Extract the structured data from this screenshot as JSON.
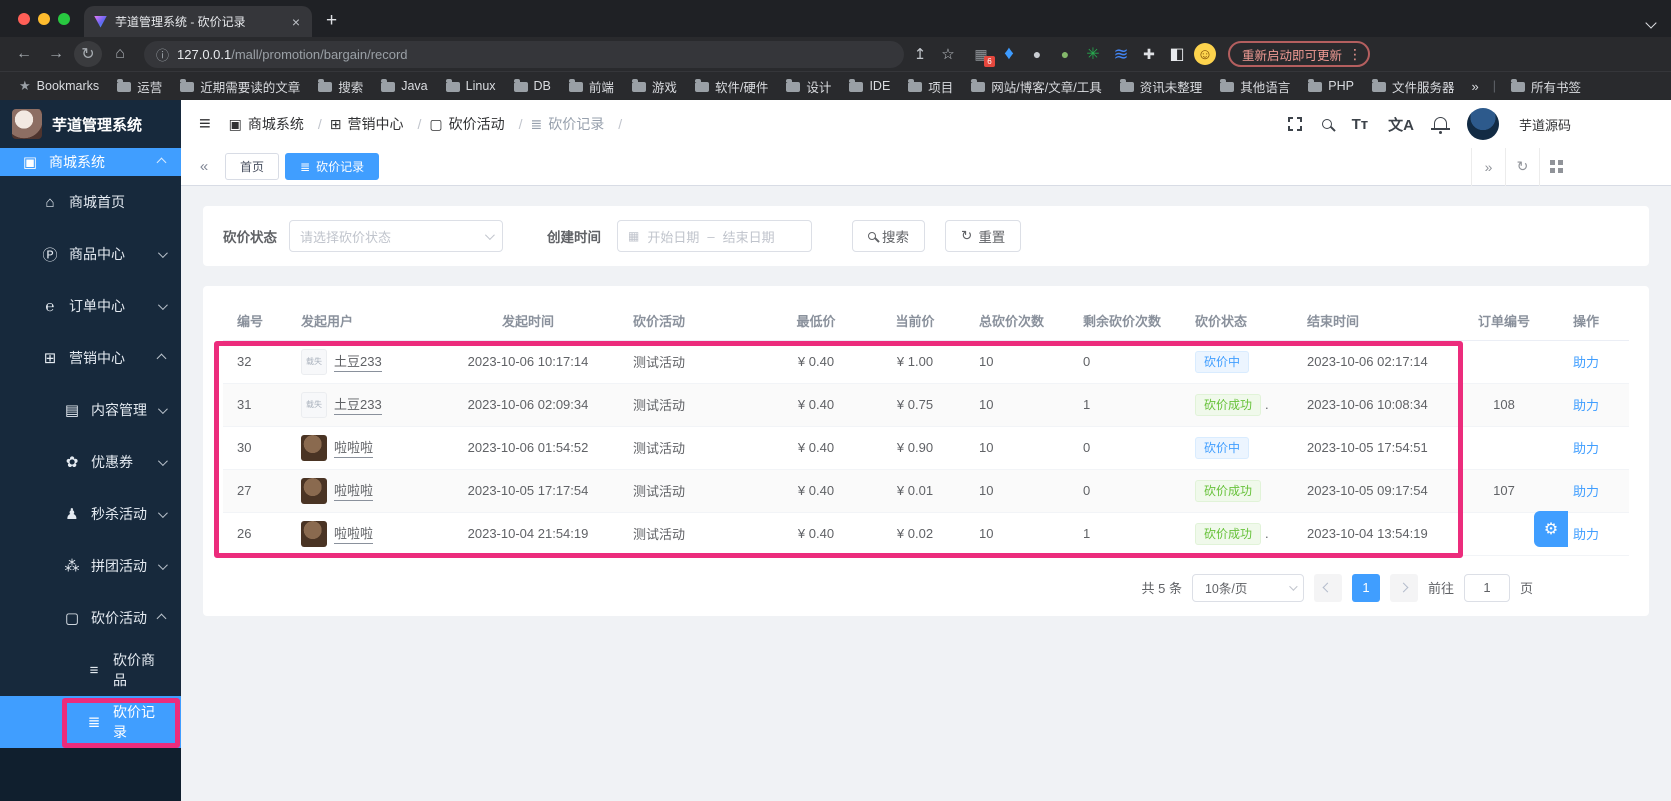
{
  "colors": {
    "primary": "#409eff",
    "success": "#67c23a",
    "annotation": "#ec2c7c",
    "sidebar_bg": "#17293c"
  },
  "chrome": {
    "tab": {
      "title": "芋道管理系统 - 砍价记录",
      "close": "×"
    },
    "new_tab": "+",
    "nav": {
      "back": "←",
      "forward": "→",
      "reload": "↻",
      "home": "⌂"
    },
    "url": {
      "info": "ⓘ",
      "host": "127.0.0.1",
      "path": "/mall/promotion/bargain/record"
    },
    "actions": {
      "share": "↥",
      "star": "☆"
    },
    "ext_icons": [
      {
        "name": "extensions-grid-icon",
        "glyph": "▦",
        "css": "color:#8f9398",
        "badge": "6"
      },
      {
        "name": "kite-extension-icon",
        "glyph": "♦",
        "css": "color:#3d9bff;font-size:19px",
        "badge": ""
      },
      {
        "name": "gray-circle-extension-icon",
        "glyph": "●",
        "css": "color:#c9cdd2",
        "badge": ""
      },
      {
        "name": "green-circle-extension-icon",
        "glyph": "●",
        "css": "color:#84b86b",
        "badge": ""
      },
      {
        "name": "green-star-extension-icon",
        "glyph": "✳",
        "css": "color:#27a94e;font-size:16px",
        "badge": ""
      },
      {
        "name": "blue-layers-extension-icon",
        "glyph": "≋",
        "css": "color:#4285f4;font-size:18px",
        "badge": ""
      },
      {
        "name": "puzzle-extension-icon",
        "glyph": "✚",
        "css": "color:#dfe1e5",
        "badge": ""
      },
      {
        "name": "side-panel-icon",
        "glyph": "◧",
        "css": "color:#e8eaed;font-size:16px",
        "badge": ""
      },
      {
        "name": "profile-avatar-icon",
        "glyph": "☺",
        "css": "color:#7c4a03;background:#fcd34d;border-radius:50%;font-size:15px",
        "badge": ""
      }
    ],
    "update": {
      "label": "重新启动即可更新",
      "menu": "⋮"
    },
    "bookmarks": {
      "star": "★",
      "label": "Bookmarks",
      "items": [
        "运营",
        "近期需要读的文章",
        "搜索",
        "Java",
        "Linux",
        "DB",
        "前端",
        "游戏",
        "软件/硬件",
        "设计",
        "IDE",
        "项目",
        "网站/博客/文章/工具",
        "资讯未整理",
        "其他语言",
        "PHP",
        "文件服务器"
      ],
      "overflow": "»",
      "all": "所有书签"
    }
  },
  "sidebar": {
    "title": "芋道管理系统",
    "items": [
      {
        "label": "商城系统",
        "glyph": "▣",
        "level": 0,
        "chev": "up",
        "state": "active"
      },
      {
        "label": "商城首页",
        "glyph": "⌂",
        "level": 1,
        "chev": "none",
        "state": ""
      },
      {
        "label": "商品中心",
        "glyph": "Ⓟ",
        "level": 1,
        "chev": "down",
        "state": ""
      },
      {
        "label": "订单中心",
        "glyph": "℮",
        "level": 1,
        "chev": "down",
        "state": ""
      },
      {
        "label": "营销中心",
        "glyph": "⊞",
        "level": 1,
        "chev": "up",
        "state": ""
      },
      {
        "label": "内容管理",
        "glyph": "▤",
        "level": 2,
        "chev": "down",
        "state": ""
      },
      {
        "label": "优惠券",
        "glyph": "✿",
        "level": 2,
        "chev": "down",
        "state": ""
      },
      {
        "label": "秒杀活动",
        "glyph": "♟",
        "level": 2,
        "chev": "down",
        "state": ""
      },
      {
        "label": "拼团活动",
        "glyph": "⁂",
        "level": 2,
        "chev": "down",
        "state": ""
      },
      {
        "label": "砍价活动",
        "glyph": "▢",
        "level": 2,
        "chev": "up",
        "state": ""
      },
      {
        "label": "砍价商品",
        "glyph": "≡",
        "level": 3,
        "chev": "none",
        "state": ""
      },
      {
        "label": "砍价记录",
        "glyph": "≣",
        "level": 3,
        "chev": "none",
        "state": "active"
      }
    ]
  },
  "header": {
    "menu_glyph": "≡",
    "breadcrumb": {
      "sep": "/",
      "items": [
        {
          "glyph": "▣",
          "label": "商城系统",
          "state": ""
        },
        {
          "glyph": "⊞",
          "label": "营销中心",
          "state": ""
        },
        {
          "glyph": "▢",
          "label": "砍价活动",
          "state": ""
        },
        {
          "glyph": "≣",
          "label": "砍价记录",
          "state": "current"
        }
      ]
    },
    "tools": {
      "font": "Tт",
      "lang": "文A"
    },
    "user": "芋道源码"
  },
  "tabbar": {
    "collapse": "«",
    "expand": "»",
    "refresh": "↻",
    "tabs": [
      {
        "label": "首页",
        "glyph": "",
        "state": ""
      },
      {
        "label": "砍价记录",
        "glyph": "≣",
        "state": "active"
      }
    ]
  },
  "filters": {
    "status_label": "砍价状态",
    "status_placeholder": "请选择砍价状态",
    "time_label": "创建时间",
    "start_placeholder": "开始日期",
    "dash": "–",
    "end_placeholder": "结束日期",
    "cal_glyph": "▦",
    "search": "搜索",
    "reset": "重置",
    "reset_glyph": "↻"
  },
  "table": {
    "columns": [
      "编号",
      "发起用户",
      "发起时间",
      "砍价活动",
      "最低价",
      "当前价",
      "总砍价次数",
      "剩余砍价次数",
      "砍价状态",
      "结束时间",
      "订单编号",
      "操作"
    ],
    "rows": [
      {
        "id": "32",
        "user": "土豆233",
        "avatar": {
          "type": "broken",
          "text": "载失"
        },
        "time": "2023-10-06 10:17:14",
        "activity": "测试活动",
        "floor": "¥ 0.40",
        "current": "¥ 1.00",
        "total": "10",
        "remain": "0",
        "status": {
          "text": "砍价中",
          "type": "processing",
          "suffix": ""
        },
        "end": "2023-10-06 02:17:14",
        "order": "",
        "action": "助力"
      },
      {
        "id": "31",
        "user": "土豆233",
        "avatar": {
          "type": "broken",
          "text": "载失"
        },
        "time": "2023-10-06 02:09:34",
        "activity": "测试活动",
        "floor": "¥ 0.40",
        "current": "¥ 0.75",
        "total": "10",
        "remain": "1",
        "status": {
          "text": "砍价成功",
          "type": "success",
          "suffix": "."
        },
        "end": "2023-10-06 10:08:34",
        "order": "108",
        "action": "助力"
      },
      {
        "id": "30",
        "user": "啦啦啦",
        "avatar": {
          "type": "photo",
          "text": ""
        },
        "time": "2023-10-06 01:54:52",
        "activity": "测试活动",
        "floor": "¥ 0.40",
        "current": "¥ 0.90",
        "total": "10",
        "remain": "0",
        "status": {
          "text": "砍价中",
          "type": "processing",
          "suffix": ""
        },
        "end": "2023-10-05 17:54:51",
        "order": "",
        "action": "助力"
      },
      {
        "id": "27",
        "user": "啦啦啦",
        "avatar": {
          "type": "photo",
          "text": ""
        },
        "time": "2023-10-05 17:17:54",
        "activity": "测试活动",
        "floor": "¥ 0.40",
        "current": "¥ 0.01",
        "total": "10",
        "remain": "0",
        "status": {
          "text": "砍价成功",
          "type": "success",
          "suffix": ""
        },
        "end": "2023-10-05 09:17:54",
        "order": "107",
        "action": "助力"
      },
      {
        "id": "26",
        "user": "啦啦啦",
        "avatar": {
          "type": "photo",
          "text": ""
        },
        "time": "2023-10-04 21:54:19",
        "activity": "测试活动",
        "floor": "¥ 0.40",
        "current": "¥ 0.02",
        "total": "10",
        "remain": "1",
        "status": {
          "text": "砍价成功",
          "type": "success",
          "suffix": "."
        },
        "end": "2023-10-04 13:54:19",
        "order": "",
        "action": "助力"
      }
    ]
  },
  "pagination": {
    "total": "共 5 条",
    "size": "10条/页",
    "page": "1",
    "goto": "前往",
    "unit": "页"
  },
  "misc": {
    "gear": "⚙"
  }
}
